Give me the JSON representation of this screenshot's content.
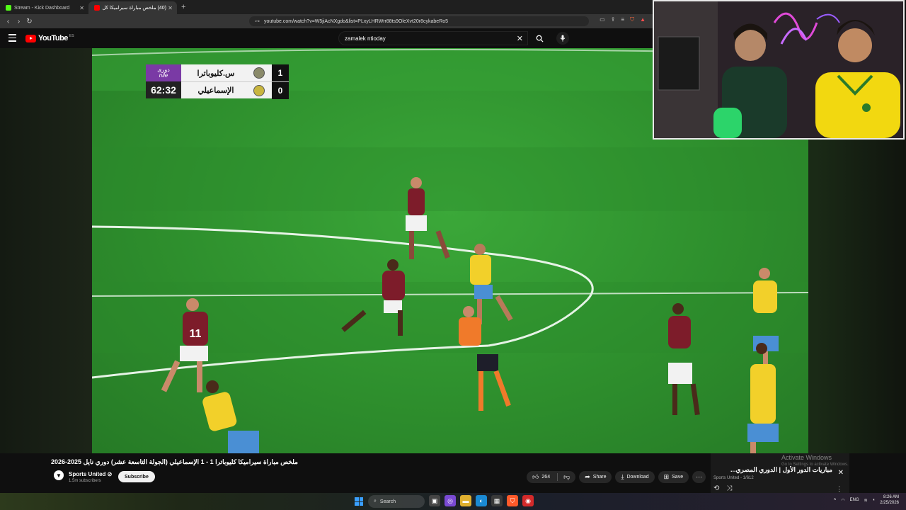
{
  "browser": {
    "tabs": [
      {
        "label": "Stream - Kick Dashboard",
        "active": false
      },
      {
        "label": "(40) ملخص مباراة سيراميكا كل...",
        "active": true
      }
    ],
    "url": "youtube.com/watch?v=W5jiAcNXgdo&list=PLxyLHRWrr88ts9OleXvt20r8cykabeRo5"
  },
  "youtube": {
    "logo_text": "YouTube",
    "country_code": "ES",
    "search_value": "zamalek ntioday",
    "video_title": "ملخص مباراة سيراميكا كليوباترا 1 - 1 الإسماعيلي (الجولة التاسعة عشر) دوري نايل 2025-2026",
    "channel": {
      "name": "Sports United ⊘",
      "subscribers": "1.5m subscribers",
      "subscribe_label": "Subscribe"
    },
    "actions": {
      "likes": "264",
      "share": "Share",
      "download": "Download",
      "save": "Save"
    },
    "playlist": {
      "title": "مباريات الدور الأول | الدوري المصري...",
      "subtitle": "Sports United - 1/612"
    }
  },
  "scoreboard": {
    "brand_line1": "دورى",
    "brand_line2": "nile",
    "clock": "62:32",
    "teams": [
      {
        "name": "س.كليوباترا",
        "score": "1"
      },
      {
        "name": "الإسماعيلي",
        "score": "0"
      }
    ]
  },
  "windows": {
    "activate_title": "Activate Windows",
    "activate_sub": "Go to Settings to activate Windows.",
    "taskbar_search": "Search",
    "language": "ENG",
    "time": "8:26 AM",
    "date": "2/25/2026"
  },
  "colors": {
    "yt_red": "#ff0000",
    "ismaily_yellow": "#f2d02a",
    "ceramica_maroon": "#7d1c2a",
    "pitch_green": "#2e8f2d"
  }
}
